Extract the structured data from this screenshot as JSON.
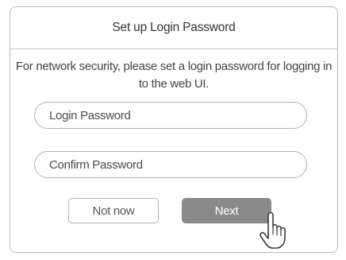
{
  "dialog": {
    "title": "Set up Login Password",
    "description": "For network security, please set a login password for logging in to the web UI.",
    "login_password": {
      "placeholder": "Login Password",
      "value": ""
    },
    "confirm_password": {
      "placeholder": "Confirm Password",
      "value": ""
    },
    "buttons": {
      "not_now": "Not now",
      "next": "Next"
    }
  },
  "cursor": {
    "icon": "hand-pointer-icon"
  },
  "colors": {
    "border": "#b9b9b9",
    "text": "#444444",
    "next_button": "#8a8a8a",
    "next_text": "#ffffff"
  }
}
